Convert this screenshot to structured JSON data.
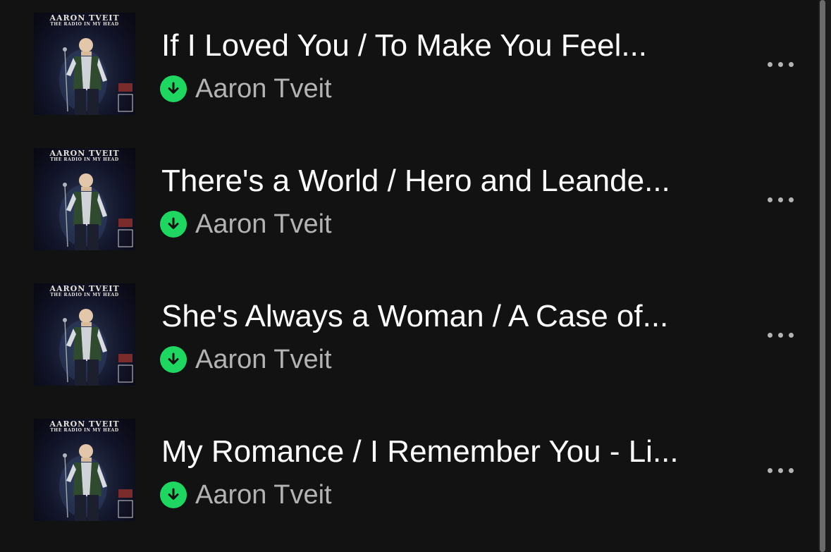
{
  "colors": {
    "background": "#121212",
    "title_text": "#ffffff",
    "secondary_text": "#b3b3b3",
    "downloaded_accent": "#1ed760"
  },
  "album_art": {
    "artist_text": "AARON TVEIT",
    "album_text": "THE RADIO IN MY HEAD",
    "badge_text": "54",
    "badge_caption": "LIVE AT"
  },
  "tracks": [
    {
      "title": "If I Loved You / To Make You Feel...",
      "artist": "Aaron Tveit",
      "status_icon": "download-complete-icon",
      "menu_icon": "more-options-icon"
    },
    {
      "title": "There's a World / Hero and Leande...",
      "artist": "Aaron Tveit",
      "status_icon": "download-complete-icon",
      "menu_icon": "more-options-icon"
    },
    {
      "title": "She's Always a Woman / A Case of...",
      "artist": "Aaron Tveit",
      "status_icon": "download-complete-icon",
      "menu_icon": "more-options-icon"
    },
    {
      "title": "My Romance / I Remember You - Li...",
      "artist": "Aaron Tveit",
      "status_icon": "download-complete-icon",
      "menu_icon": "more-options-icon"
    }
  ]
}
